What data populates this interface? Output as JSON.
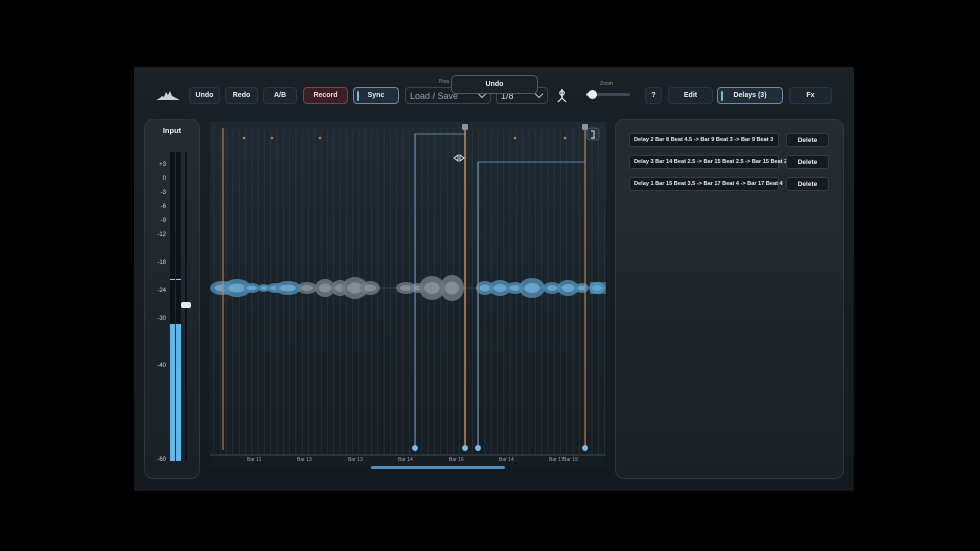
{
  "toolbar": {
    "undo": "Undo",
    "redo": "Redo",
    "ab": "A/B",
    "record": "Record",
    "sync": "Sync",
    "preset_label": "Pres",
    "preset_value": "Load / Save",
    "grid_value": "1/8",
    "zoom_label": "Zoom",
    "zoom_level": 0.15,
    "help": "?",
    "edit": "Edit",
    "delays": "Delays (3)",
    "fx": "Fx"
  },
  "tooltip": {
    "text": "Undo"
  },
  "input_meter": {
    "title": "Input",
    "scale": [
      "+3",
      "0",
      "-3",
      "-6",
      "-9",
      "-12",
      "-18",
      "-24",
      "-30",
      "-40",
      "-60"
    ],
    "accent": "#5fb6ea"
  },
  "timeline": {
    "bar_labels": [
      "Bar 11",
      "Bar 13",
      "Bar 13",
      "Bar 14",
      "Bar 16",
      "Bar 14",
      "Bar 17",
      "Bar 19"
    ],
    "marker_icon": "resize-arrows-icon",
    "corner_icon": "square-bracket-icon"
  },
  "delays": [
    {
      "label": "Delay 2  Bar 8 Beat 4.5 -> Bar 9 Beat 3 -> Bar 9 Beat 3",
      "delete": "Delete"
    },
    {
      "label": "Delay 3  Bar 14 Beat 2.5 -> Bar 15 Beat 2.5 -> Bar 15 Beat 2.5",
      "delete": "Delete"
    },
    {
      "label": "Delay 1  Bar 15 Beat 3.5 -> Bar 17 Beat 4 -> Bar 17 Beat 4",
      "delete": "Delete"
    }
  ],
  "colors": {
    "orange": "#d88a4a",
    "blue": "#5aa6d8",
    "record": "#8a3a46"
  }
}
